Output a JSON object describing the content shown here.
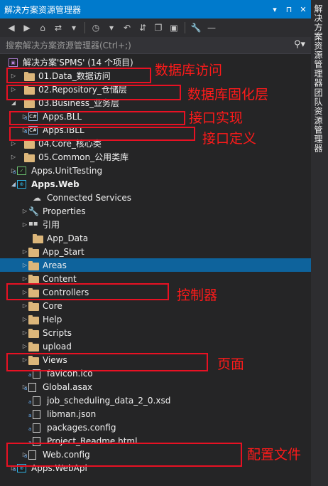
{
  "window": {
    "title": "解决方案资源管理器",
    "pin_glyph": "▾ ⊓ ×"
  },
  "toolbar": {
    "icons": [
      "back-icon",
      "forward-icon",
      "home-icon",
      "sync-icon",
      "history-icon",
      "undo-icon",
      "collapse-icon",
      "copy-icon",
      "show-all-icon",
      "wrench-icon",
      "minus-icon"
    ]
  },
  "search": {
    "placeholder": "搜索解决方案资源管理器(Ctrl+;)"
  },
  "right_tabs": [
    "解决方案资源管理器",
    "团队资源管理器"
  ],
  "tree": [
    {
      "label": "解决方案'SPMS' (14 个项目)",
      "icon": "solution-icon"
    },
    {
      "label": "01.Data_数据访问",
      "icon": "folder-icon"
    },
    {
      "label": "02.Repository_仓储层",
      "icon": "folder-icon"
    },
    {
      "label": "03.Business_业务层",
      "icon": "folder-icon"
    },
    {
      "label": "Apps.BLL",
      "icon": "csharp-project-icon"
    },
    {
      "label": "Apps.IBLL",
      "icon": "csharp-project-icon"
    },
    {
      "label": "04.Core_核心类",
      "icon": "folder-icon"
    },
    {
      "label": "05.Common_公用类库",
      "icon": "folder-icon"
    },
    {
      "label": "Apps.UnitTesting",
      "icon": "test-project-icon"
    },
    {
      "label": "Apps.Web",
      "icon": "web-project-icon"
    },
    {
      "label": "Connected Services",
      "icon": "connected-services-icon"
    },
    {
      "label": "Properties",
      "icon": "wrench-icon"
    },
    {
      "label": "引用",
      "icon": "references-icon"
    },
    {
      "label": "App_Data",
      "icon": "folder-icon"
    },
    {
      "label": "App_Start",
      "icon": "folder-icon"
    },
    {
      "label": "Areas",
      "icon": "folder-icon"
    },
    {
      "label": "Content",
      "icon": "folder-icon"
    },
    {
      "label": "Controllers",
      "icon": "folder-icon"
    },
    {
      "label": "Core",
      "icon": "folder-icon"
    },
    {
      "label": "Help",
      "icon": "folder-icon"
    },
    {
      "label": "Scripts",
      "icon": "folder-icon"
    },
    {
      "label": "upload",
      "icon": "folder-icon"
    },
    {
      "label": "Views",
      "icon": "folder-icon"
    },
    {
      "label": "favicon.ico",
      "icon": "image-file-icon"
    },
    {
      "label": "Global.asax",
      "icon": "asax-file-icon"
    },
    {
      "label": "job_scheduling_data_2_0.xsd",
      "icon": "xsd-file-icon"
    },
    {
      "label": "libman.json",
      "icon": "json-file-icon"
    },
    {
      "label": "packages.config",
      "icon": "config-file-icon"
    },
    {
      "label": "Project_Readme.html",
      "icon": "html-file-icon"
    },
    {
      "label": "Web.config",
      "icon": "config-file-icon"
    },
    {
      "label": "Apps.WebApi",
      "icon": "web-project-icon"
    }
  ],
  "annotations": {
    "data": "数据库访问",
    "repository": "数据库固化层",
    "bll": "接口实现",
    "ibll": "接口定义",
    "controllers": "控制器",
    "views": "页面",
    "config": "配置文件"
  },
  "colors": {
    "accent": "#007acc",
    "selected": "#0e639c",
    "annotation": "#e81123",
    "background": "#252526"
  }
}
